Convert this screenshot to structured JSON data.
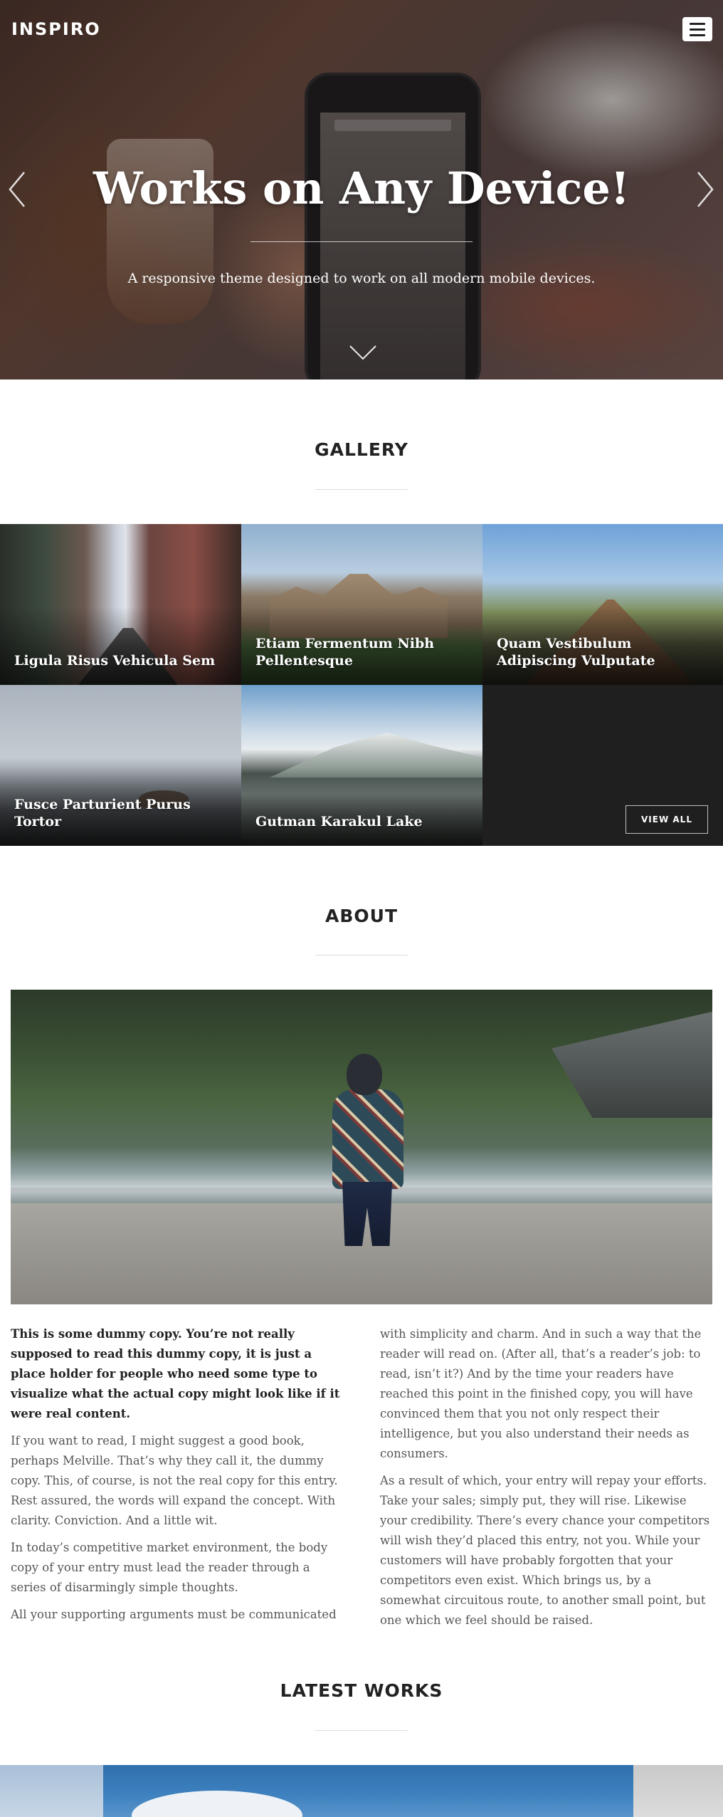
{
  "header": {
    "logo": "INSPIRO",
    "menu_icon": "hamburger-menu-icon"
  },
  "hero": {
    "title": "Works on Any Device!",
    "subtitle": "A responsive theme designed to work on all modern mobile devices.",
    "prev_icon": "chevron-left-icon",
    "next_icon": "chevron-right-icon",
    "scroll_icon": "chevron-down-icon"
  },
  "gallery": {
    "title": "GALLERY",
    "items": [
      {
        "caption": "Ligula Risus Vehicula Sem"
      },
      {
        "caption": "Etiam Fermentum Nibh Pellentesque"
      },
      {
        "caption": "Quam Vestibulum Adipiscing Vulputate"
      },
      {
        "caption": "Fusce Parturient Purus Tortor"
      },
      {
        "caption": "Gutman Karakul Lake"
      }
    ],
    "view_all_label": "VIEW ALL"
  },
  "about": {
    "title": "ABOUT",
    "left_column": [
      "This is some dummy copy. You’re not really supposed to read this dummy copy, it is just a place holder for people who need some type to visualize what the actual copy might look like if it were real content.",
      "If you want to read, I might suggest a good book, perhaps Melville. That’s why they call it, the dummy copy. This, of course, is not the real copy for this entry. Rest assured, the words will expand the concept. With clarity. Conviction. And a little wit.",
      "In today’s competitive market environment, the body copy of your entry must lead the reader through a series of disarmingly simple thoughts.",
      "All your supporting arguments must be communicated"
    ],
    "right_column": [
      "with simplicity and charm. And in such a way that the reader will read on. (After all, that’s a reader’s job: to read, isn’t it?) And by the time your readers have reached this point in the finished copy, you will have convinced them that you not only respect their intelligence, but you also understand their needs as consumers.",
      "As a result of which, your entry will repay your efforts. Take your sales; simply put, they will rise. Likewise your credibility. There’s every chance your competitors will wish they’d placed this entry, not you. While your customers will have probably forgotten that your competitors even exist. Which brings us, by a somewhat circuitous route, to another small point, but one which we feel should be raised."
    ]
  },
  "latest_works": {
    "title": "LATEST WORKS"
  }
}
